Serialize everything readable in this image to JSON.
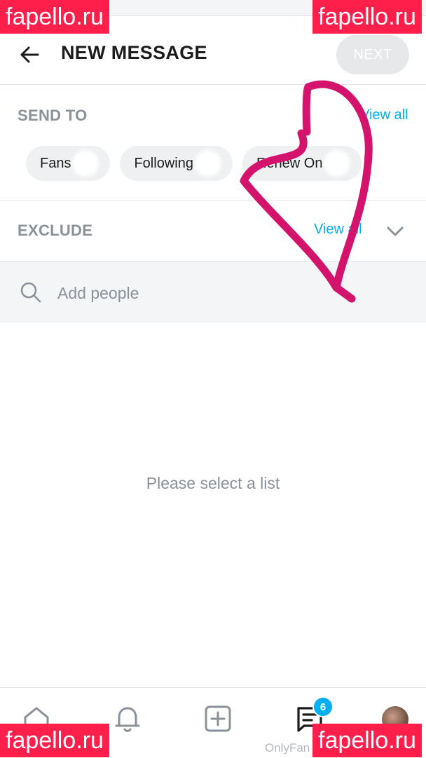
{
  "header": {
    "title": "NEW MESSAGE",
    "next_label": "NEXT"
  },
  "send_to": {
    "label": "SEND TO",
    "view_all": "View all",
    "chips": [
      {
        "label": "Fans"
      },
      {
        "label": "Following"
      },
      {
        "label": "Renew On"
      }
    ]
  },
  "exclude": {
    "label": "EXCLUDE",
    "view_all": "View all"
  },
  "search": {
    "placeholder": "Add people"
  },
  "empty_state": {
    "text": "Please select a list"
  },
  "bottom_nav": {
    "messages_badge": "6",
    "app_caption": "OnlyFan"
  },
  "watermark": {
    "text": "fapello.ru"
  },
  "colors": {
    "accent": "#00aff0",
    "watermark": "#ff1f4b",
    "heart": "#d4146c"
  }
}
